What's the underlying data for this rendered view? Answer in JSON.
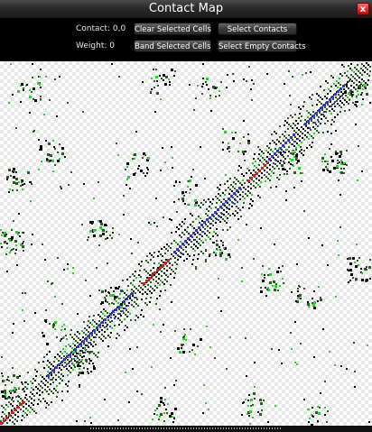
{
  "window": {
    "title": "Contact Map",
    "close_label": "x"
  },
  "controls": {
    "contact_label": "Contact: 0,0",
    "weight_label": "Weight: 0",
    "buttons": {
      "clear_selected": "Clear Selected Cells",
      "select_contacts": "Select Contacts",
      "band_selected": "Band Selected Cells",
      "select_empty": "Select Empty Contacts"
    }
  },
  "colors": {
    "dark_green": "#2b5a22",
    "light_green": "#26d426",
    "black": "#000000",
    "blue": "#3535c8",
    "red": "#d42020"
  }
}
